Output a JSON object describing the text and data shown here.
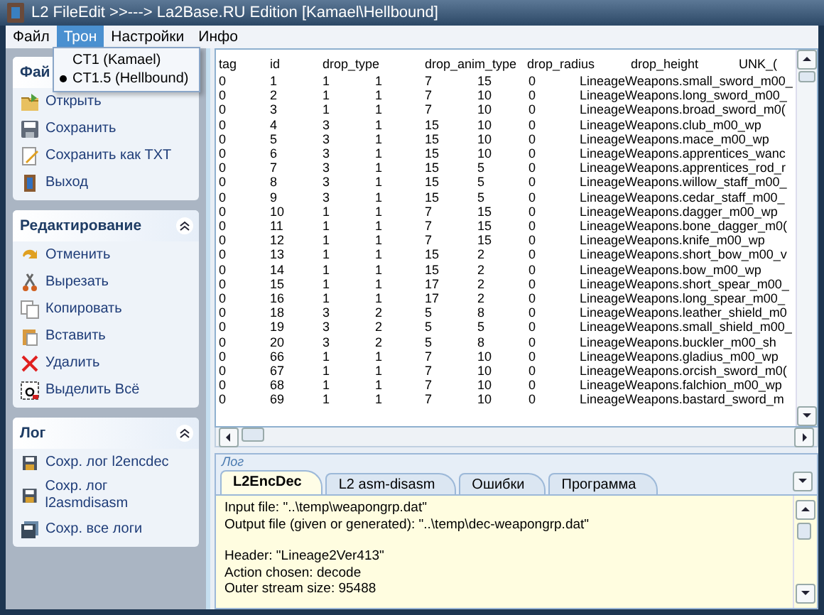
{
  "window": {
    "title": "L2 FileEdit >>---> La2Base.RU  Edition [Kamael\\Hellbound]"
  },
  "menu": [
    {
      "label": "Файл",
      "selected": false
    },
    {
      "label": "Трон",
      "selected": true
    },
    {
      "label": "Настройки",
      "selected": false
    },
    {
      "label": "Инфо",
      "selected": false
    }
  ],
  "dropdown": [
    {
      "label": "CT1 (Kamael)",
      "selected": false
    },
    {
      "label": "CT1.5 (Hellbound)",
      "selected": true
    }
  ],
  "sidebar": [
    {
      "title": "Фай",
      "items": [
        {
          "label": "Открыть",
          "kind": "open"
        },
        {
          "label": "Сохранить",
          "kind": "save"
        },
        {
          "label": "Сохранить как TXT",
          "kind": "edit"
        },
        {
          "label": "Выход",
          "kind": "exit"
        }
      ]
    },
    {
      "title": "Редактирование",
      "collapsible": true,
      "items": [
        {
          "label": "Отменить",
          "kind": "undo"
        },
        {
          "label": "Вырезать",
          "kind": "cut"
        },
        {
          "label": "Копировать",
          "kind": "copy"
        },
        {
          "label": "Вставить",
          "kind": "paste"
        },
        {
          "label": "Удалить",
          "kind": "delete"
        },
        {
          "label": "Выделить Всё",
          "kind": "selectall"
        }
      ]
    },
    {
      "title": "Лог",
      "collapsible": true,
      "items": [
        {
          "label": "Сохр. лог l2encdec",
          "kind": "disk"
        },
        {
          "label": "Сохр. лог l2asmdisasm",
          "kind": "disk"
        },
        {
          "label": "Сохр. все логи",
          "kind": "disks"
        }
      ]
    }
  ],
  "table": {
    "header_labels": [
      "tag",
      "id",
      "drop_type",
      "drop_anim_type",
      "drop_radius",
      "drop_height",
      "UNK_("
    ],
    "rows": [
      [
        "0",
        "1",
        "1",
        "1",
        "7",
        "15",
        "0",
        "LineageWeapons.small_sword_m00_"
      ],
      [
        "0",
        "2",
        "1",
        "1",
        "7",
        "10",
        "0",
        "LineageWeapons.long_sword_m00_"
      ],
      [
        "0",
        "3",
        "1",
        "1",
        "7",
        "10",
        "0",
        "LineageWeapons.broad_sword_m0("
      ],
      [
        "0",
        "4",
        "3",
        "1",
        "15",
        "10",
        "0",
        "LineageWeapons.club_m00_wp"
      ],
      [
        "0",
        "5",
        "3",
        "1",
        "15",
        "10",
        "0",
        "LineageWeapons.mace_m00_wp"
      ],
      [
        "0",
        "6",
        "3",
        "1",
        "15",
        "10",
        "0",
        "LineageWeapons.apprentices_wanc"
      ],
      [
        "0",
        "7",
        "3",
        "1",
        "15",
        "5",
        "0",
        "LineageWeapons.apprentices_rod_r"
      ],
      [
        "0",
        "8",
        "3",
        "1",
        "15",
        "5",
        "0",
        "LineageWeapons.willow_staff_m00_"
      ],
      [
        "0",
        "9",
        "3",
        "1",
        "15",
        "5",
        "0",
        "LineageWeapons.cedar_staff_m00_"
      ],
      [
        "0",
        "10",
        "1",
        "1",
        "7",
        "15",
        "0",
        "LineageWeapons.dagger_m00_wp"
      ],
      [
        "0",
        "11",
        "1",
        "1",
        "7",
        "15",
        "0",
        "LineageWeapons.bone_dagger_m0("
      ],
      [
        "0",
        "12",
        "1",
        "1",
        "7",
        "15",
        "0",
        "LineageWeapons.knife_m00_wp"
      ],
      [
        "0",
        "13",
        "1",
        "1",
        "15",
        "2",
        "0",
        "LineageWeapons.short_bow_m00_v"
      ],
      [
        "0",
        "14",
        "1",
        "1",
        "15",
        "2",
        "0",
        "LineageWeapons.bow_m00_wp"
      ],
      [
        "0",
        "15",
        "1",
        "1",
        "17",
        "2",
        "0",
        "LineageWeapons.short_spear_m00_"
      ],
      [
        "0",
        "16",
        "1",
        "1",
        "17",
        "2",
        "0",
        "LineageWeapons.long_spear_m00_"
      ],
      [
        "0",
        "18",
        "3",
        "2",
        "5",
        "8",
        "0",
        "LineageWeapons.leather_shield_m0"
      ],
      [
        "0",
        "19",
        "3",
        "2",
        "5",
        "5",
        "0",
        "LineageWeapons.small_shield_m00_"
      ],
      [
        "0",
        "20",
        "3",
        "2",
        "5",
        "8",
        "0",
        "LineageWeapons.buckler_m00_sh"
      ],
      [
        "0",
        "66",
        "1",
        "1",
        "7",
        "10",
        "0",
        "LineageWeapons.gladius_m00_wp"
      ],
      [
        "0",
        "67",
        "1",
        "1",
        "7",
        "10",
        "0",
        "LineageWeapons.orcish_sword_m0("
      ],
      [
        "0",
        "68",
        "1",
        "1",
        "7",
        "10",
        "0",
        "LineageWeapons.falchion_m00_wp"
      ],
      [
        "0",
        "69",
        "1",
        "1",
        "7",
        "10",
        "0",
        "LineageWeapons.bastard_sword_m"
      ]
    ]
  },
  "log": {
    "group_label": "Лог",
    "tabs": [
      {
        "label": "L2EncDec",
        "selected": true
      },
      {
        "label": "L2 asm-disasm",
        "selected": false
      },
      {
        "label": "Ошибки",
        "selected": false
      },
      {
        "label": "Программа",
        "selected": false
      }
    ],
    "blocks": [
      [
        "Input file: \"..\\temp\\weapongrp.dat\"",
        "Output file (given or generated): \"..\\temp\\dec-weapongrp.dat\""
      ],
      [
        "Header: \"Lineage2Ver413\"",
        "Action chosen: decode",
        "Outer stream size: 95488"
      ]
    ]
  }
}
